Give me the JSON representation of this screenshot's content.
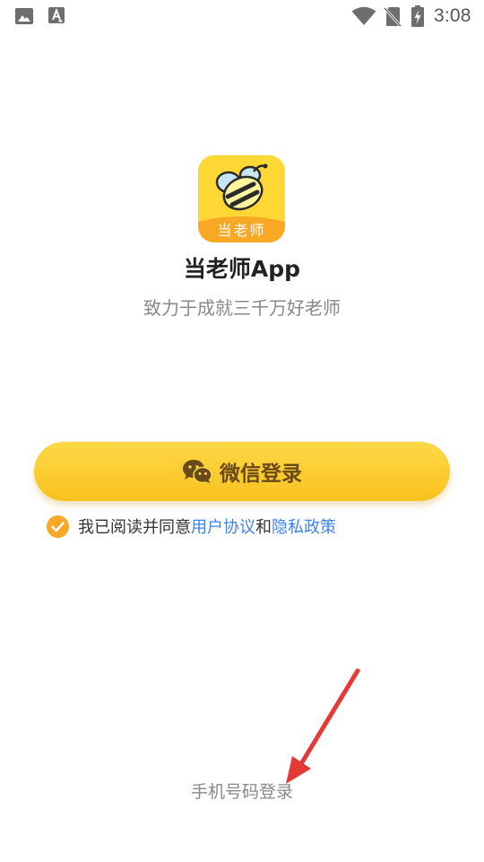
{
  "status_bar": {
    "time": "3:08",
    "icons": [
      "gallery-icon",
      "text-a-icon",
      "wifi-icon",
      "no-sim-icon",
      "battery-charging-icon"
    ]
  },
  "app": {
    "logo_text": "当老师",
    "title": "当老师App",
    "subtitle": "致力于成就三千万好老师"
  },
  "login": {
    "wechat_button_label": "微信登录",
    "agreement_prefix": "我已阅读并同意",
    "user_agreement_link": "用户协议",
    "agreement_joiner": "和",
    "privacy_policy_link": "隐私政策",
    "agreement_checked": true,
    "phone_login_label": "手机号码登录"
  },
  "colors": {
    "brand_yellow": "#fdd835",
    "button_gradient_top": "#fdd849",
    "button_gradient_bottom": "#f9c21d",
    "button_text": "#6b4a1a",
    "check_orange": "#f9a825",
    "link_blue": "#3d82f0",
    "annotation_red": "#e53935"
  }
}
